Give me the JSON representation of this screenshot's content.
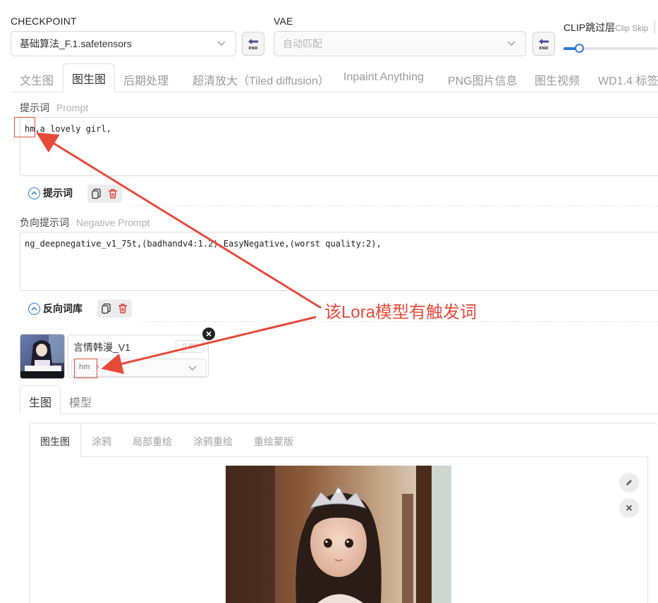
{
  "checkpoint": {
    "label": "CHECKPOINT",
    "value": "基础算法_F.1.safetensors"
  },
  "vae": {
    "label": "VAE",
    "value": "自动匹配"
  },
  "clip": {
    "label": "CLIP跳过层",
    "sub": "Clip Skip"
  },
  "end_btn_text": "END",
  "tabs": [
    {
      "label": "文生图"
    },
    {
      "label": "图生图"
    },
    {
      "label": "后期处理"
    },
    {
      "label": "超清放大（Tiled diffusion）"
    },
    {
      "label": "Inpaint Anything"
    },
    {
      "label": "PNG图片信息"
    },
    {
      "label": "图生视频"
    },
    {
      "label": "WD1.4 标签器"
    }
  ],
  "prompt": {
    "label": "提示词",
    "sub": "Prompt",
    "text_trigger": "hm",
    "text_rest": ",a lovely girl,",
    "library_label": "提示词"
  },
  "negative": {
    "label": "负向提示词",
    "sub": "Negative Prompt",
    "text": "ng_deepnegative_v1_75t,(badhandv4:1.2),EasyNegative,(worst quality:2),",
    "library_label": "反向词库"
  },
  "lora": {
    "name": "言情韩漫_V1",
    "weight": "0.80",
    "tag": "hm"
  },
  "annotation": "该Lora模型有触发词",
  "sub_tabs": [
    {
      "label": "生图"
    },
    {
      "label": "模型"
    }
  ],
  "mini_tabs": [
    {
      "label": "图生图"
    },
    {
      "label": "涂鸦"
    },
    {
      "label": "局部重绘"
    },
    {
      "label": "涂鸦重绘"
    },
    {
      "label": "重绘蒙版"
    }
  ],
  "colors": {
    "accent": "#2b7bd9",
    "annotation": "#e84a3a",
    "delete": "#d9413a"
  }
}
